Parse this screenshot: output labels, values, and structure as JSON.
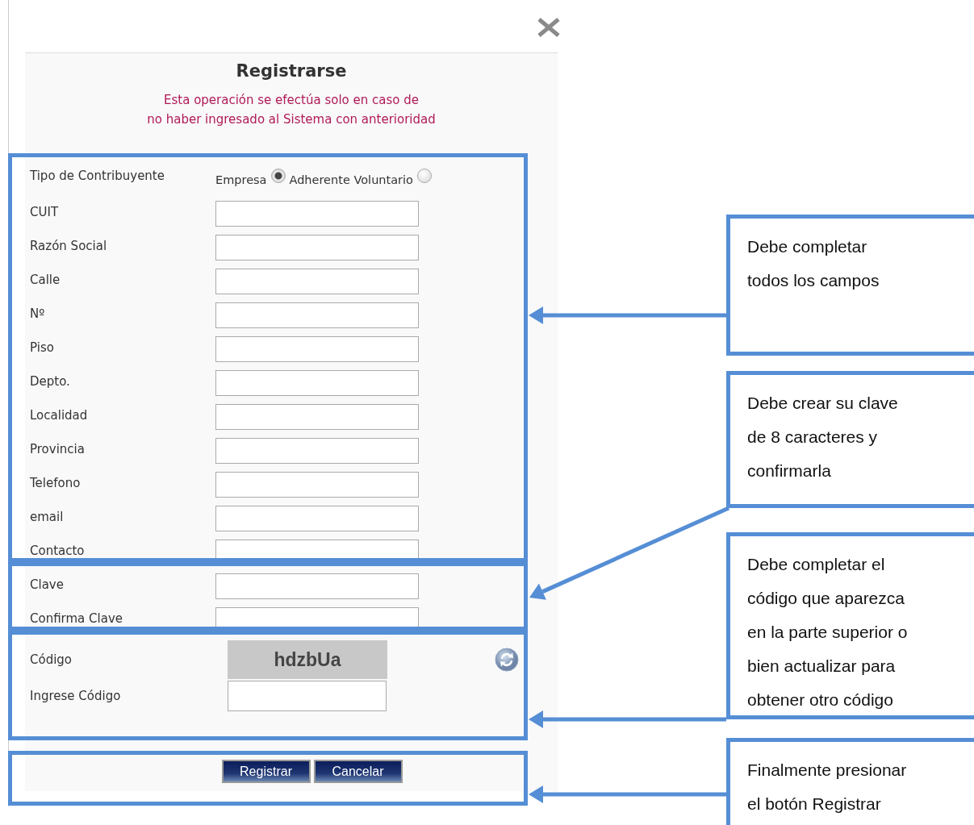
{
  "dialog": {
    "title": "Registrarse",
    "notice_lines": [
      "Esta operación se efectúa solo en caso de",
      "no haber ingresado al Sistema con anterioridad"
    ],
    "taxpayer_type": {
      "label": "Tipo de Contribuyente",
      "options": [
        {
          "label": "Empresa",
          "selected": true
        },
        {
          "label": "Adherente Voluntario",
          "selected": false
        }
      ]
    },
    "fields": [
      {
        "label": "CUIT"
      },
      {
        "label": "Razón Social"
      },
      {
        "label": "Calle"
      },
      {
        "label": "Nº"
      },
      {
        "label": "Piso"
      },
      {
        "label": "Depto."
      },
      {
        "label": "Localidad"
      },
      {
        "label": "Provincia"
      },
      {
        "label": "Telefono"
      },
      {
        "label": "email"
      },
      {
        "label": "Contacto"
      },
      {
        "label": "Clave"
      },
      {
        "label": "Confirma Clave"
      }
    ],
    "captcha": {
      "label": "Código",
      "code": "hdzbUa"
    },
    "code_field": {
      "label": "Ingrese Código"
    },
    "buttons": [
      "Registrar",
      "Cancelar"
    ]
  },
  "annotations": [
    {
      "text": "Debe completar\ntodos los campos"
    },
    {
      "text": "Debe crear su clave\nde 8 caracteres y\nconfirmarla"
    },
    {
      "text": "Debe completar el\ncódigo que aparezca\nen la parte superior o\nbien actualizar para\nobtener otro código"
    },
    {
      "text": "Finalmente presionar\nel botón Registrar"
    }
  ]
}
